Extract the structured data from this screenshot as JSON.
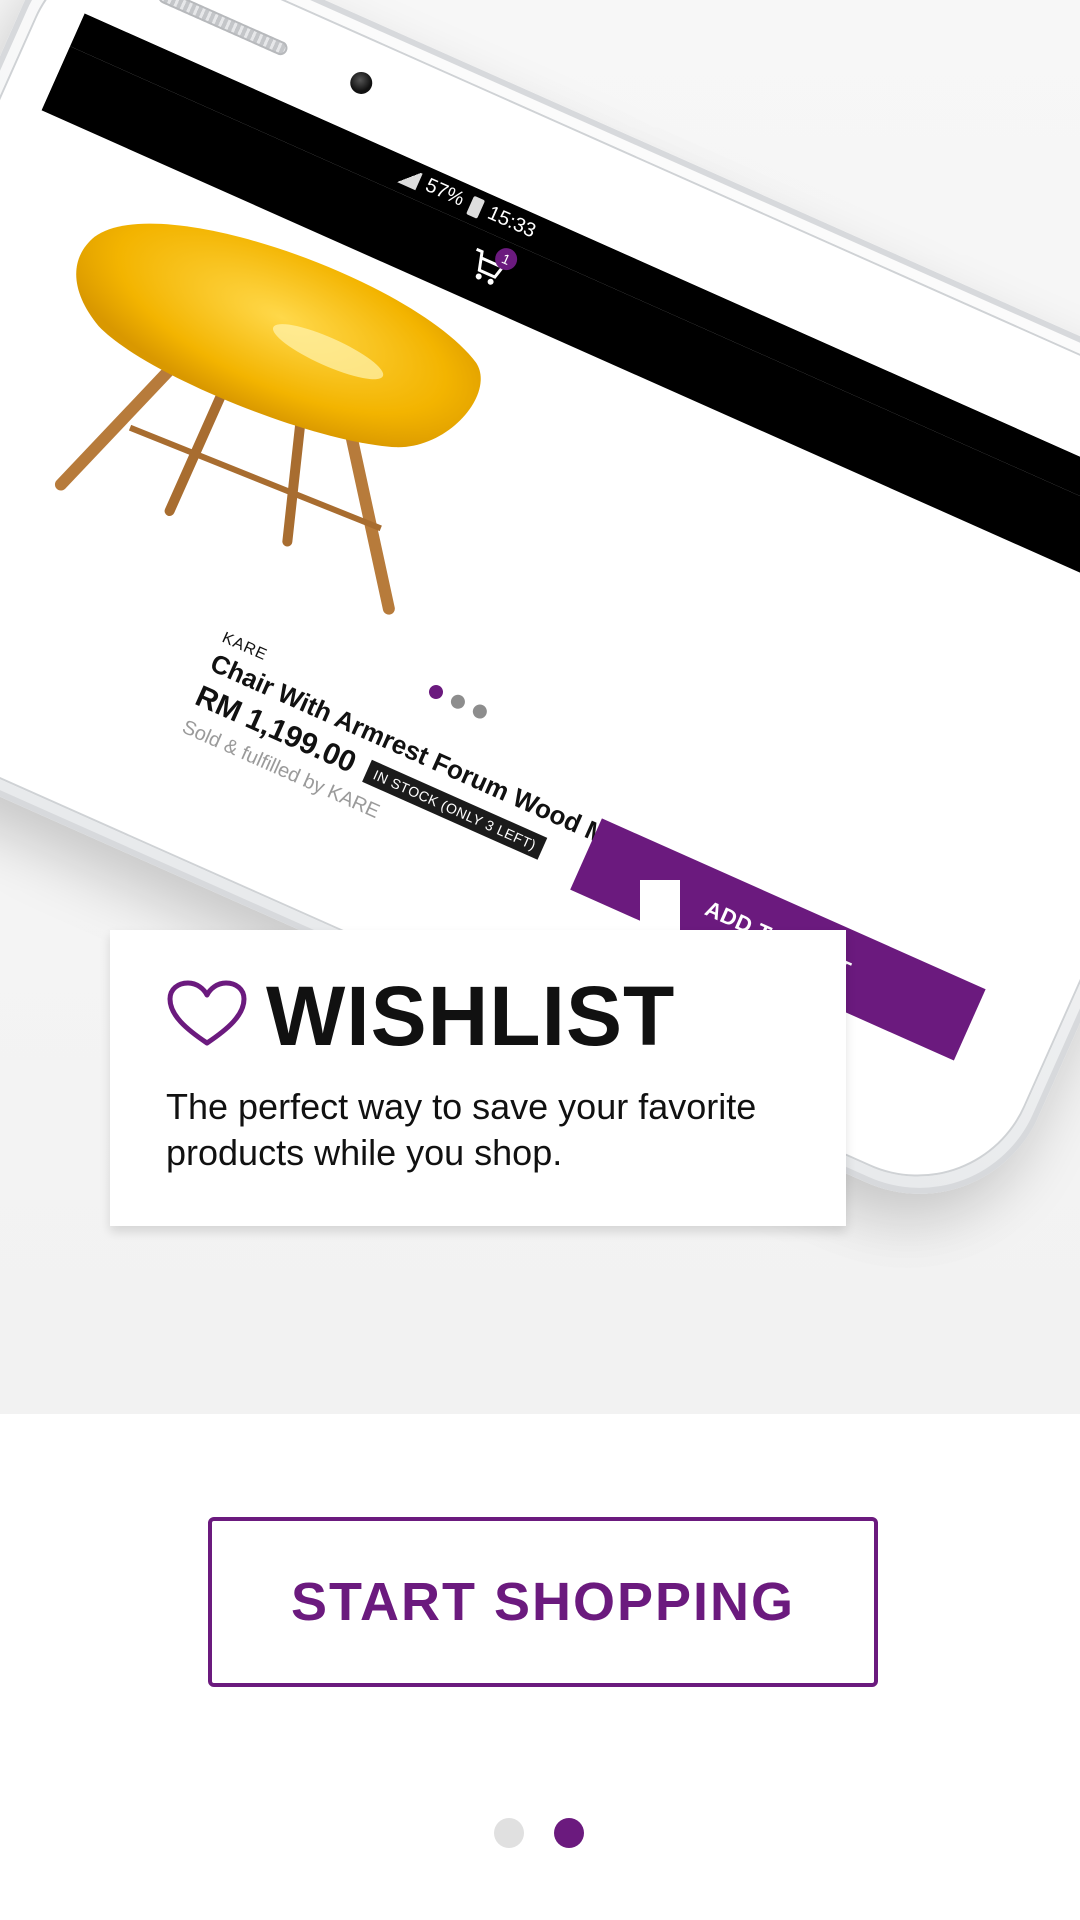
{
  "colors": {
    "accent": "#6b1a7e",
    "text": "#111111",
    "background": "#ffffff"
  },
  "phone_screen": {
    "status": {
      "signal_percent": "57%",
      "time": "15:33"
    },
    "cart_count": "1",
    "brand": "KARE",
    "product_name": "Chair With Armrest Forum Wood Mustard",
    "price": "RM 1,199.00",
    "stock_badge": "IN STOCK (ONLY 3 LEFT)",
    "sold_by": "Sold & fulfilled by KARE",
    "add_to_cart": "ADD TO CART",
    "image_dots": {
      "count": 3,
      "active": 0
    }
  },
  "feature": {
    "icon": "heart-outline-icon",
    "title": "WISHLIST",
    "description": "The perfect way to save your favorite products while you shop."
  },
  "cta": {
    "label": "START SHOPPING"
  },
  "pager": {
    "count": 2,
    "active": 1
  }
}
